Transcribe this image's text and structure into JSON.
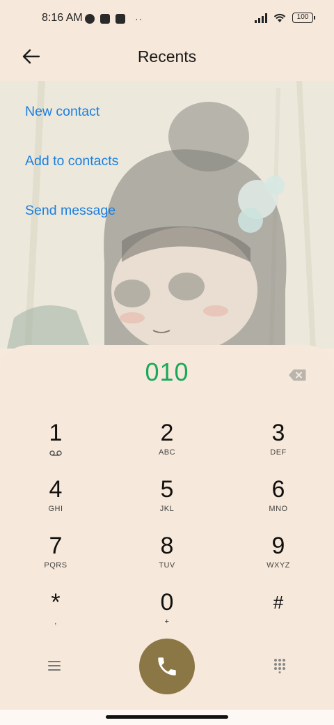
{
  "status_bar": {
    "time": "8:16 AM",
    "more_dots": "··",
    "battery": "100",
    "icons": [
      "app-icon",
      "square-icon",
      "upload-icon",
      "signal-icon",
      "wifi-icon",
      "battery-icon"
    ]
  },
  "header": {
    "title": "Recents",
    "back_icon": "back-arrow-icon"
  },
  "actions": [
    {
      "label": "New contact"
    },
    {
      "label": "Add to contacts"
    },
    {
      "label": "Send message"
    }
  ],
  "dialer": {
    "number": "010",
    "backspace_icon": "backspace-icon",
    "keys": [
      {
        "digit": "1",
        "letters": ""
      },
      {
        "digit": "2",
        "letters": "ABC"
      },
      {
        "digit": "3",
        "letters": "DEF"
      },
      {
        "digit": "4",
        "letters": "GHI"
      },
      {
        "digit": "5",
        "letters": "JKL"
      },
      {
        "digit": "6",
        "letters": "MNO"
      },
      {
        "digit": "7",
        "letters": "PQRS"
      },
      {
        "digit": "8",
        "letters": "TUV"
      },
      {
        "digit": "9",
        "letters": "WXYZ"
      },
      {
        "digit": "*",
        "letters": ","
      },
      {
        "digit": "0",
        "letters": "+"
      },
      {
        "digit": "#",
        "letters": ""
      }
    ]
  },
  "colors": {
    "accent_link": "#1a7fe0",
    "number": "#1aa85a",
    "call_button": "#8b7745",
    "background": "#f6e8da"
  }
}
